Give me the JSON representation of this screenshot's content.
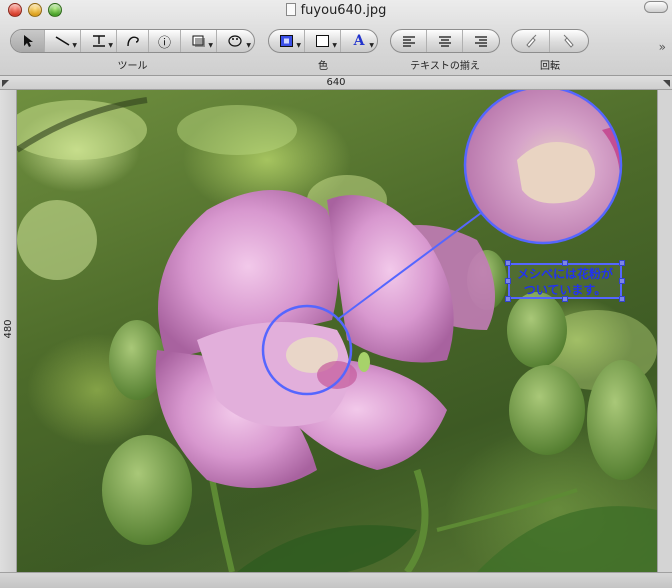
{
  "window": {
    "title": "fuyou640.jpg"
  },
  "toolbar": {
    "groups": [
      {
        "label": "ツール",
        "tools": [
          "pointer-tool",
          "line-tool",
          "text-tool",
          "lasso-tool",
          "info-tool",
          "shadow-tool",
          "style-tool"
        ]
      },
      {
        "label": "色",
        "tools": [
          "fill-color",
          "stroke-color",
          "text-color"
        ]
      },
      {
        "label": "テキストの揃え",
        "tools": [
          "align-left",
          "align-center",
          "align-right"
        ]
      },
      {
        "label": "回転",
        "tools": [
          "rotate-left",
          "rotate-right"
        ]
      }
    ],
    "text_color_glyph": "A",
    "info_glyph": "ⓘ",
    "more_glyph": "»"
  },
  "rulers": {
    "width_label": "640",
    "height_label": "480"
  },
  "annotation": {
    "line1": "メシベには花粉が",
    "line2": "ついています。",
    "color": "#5566ff"
  },
  "colors": {
    "accent": "#5566ff",
    "petal": "#d99ad0"
  }
}
